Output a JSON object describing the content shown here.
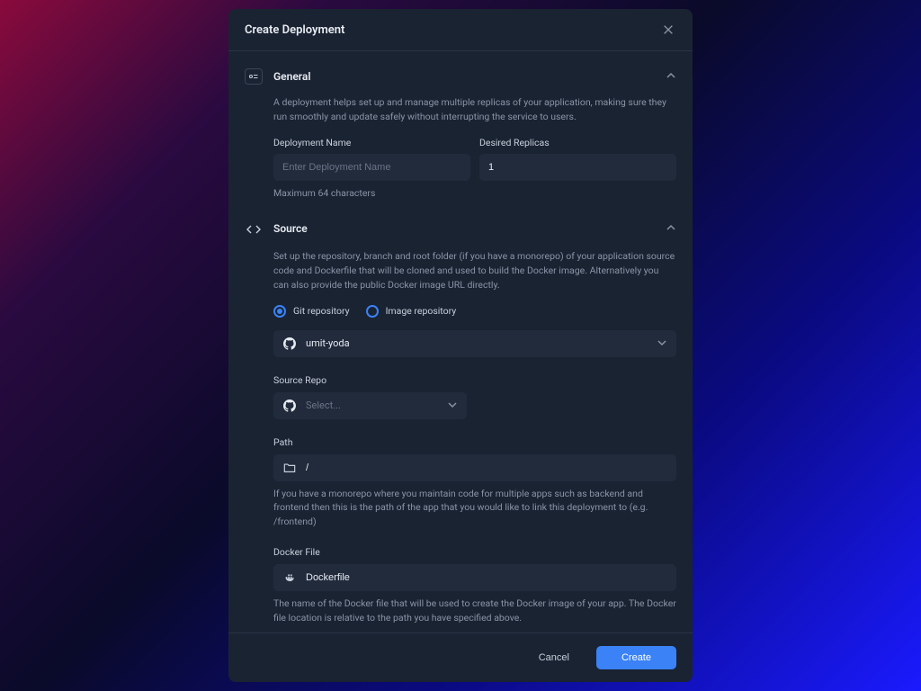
{
  "modal": {
    "title": "Create Deployment"
  },
  "general": {
    "title": "General",
    "description": "A deployment helps set up and manage multiple replicas of your application, making sure they run smoothly and update safely without interrupting the service to users.",
    "name_label": "Deployment Name",
    "name_placeholder": "Enter Deployment Name",
    "name_hint": "Maximum 64 characters",
    "replicas_label": "Desired Replicas",
    "replicas_value": "1"
  },
  "source": {
    "title": "Source",
    "description": "Set up the repository, branch and root folder (if you have a monorepo) of your application source code and Dockerfile that will be cloned and used to build the Docker image. Alternatively you can also provide the public Docker image URL directly.",
    "radio_git": "Git repository",
    "radio_image": "Image repository",
    "account_value": "umit-yoda",
    "repo_label": "Source Repo",
    "repo_placeholder": "Select...",
    "path_label": "Path",
    "path_value": "/",
    "path_hint": "If you have a monorepo where you maintain code for multiple apps such as backend and frontend then this is the path of the app that you would like to link this deployment to (e.g. /frontend)",
    "docker_label": "Docker File",
    "docker_value": "Dockerfile",
    "docker_hint": "The name of the Docker file that will be used to create the Docker image of your app. The Docker file location is relative to the path you have specified above."
  },
  "footer": {
    "cancel": "Cancel",
    "create": "Create"
  }
}
